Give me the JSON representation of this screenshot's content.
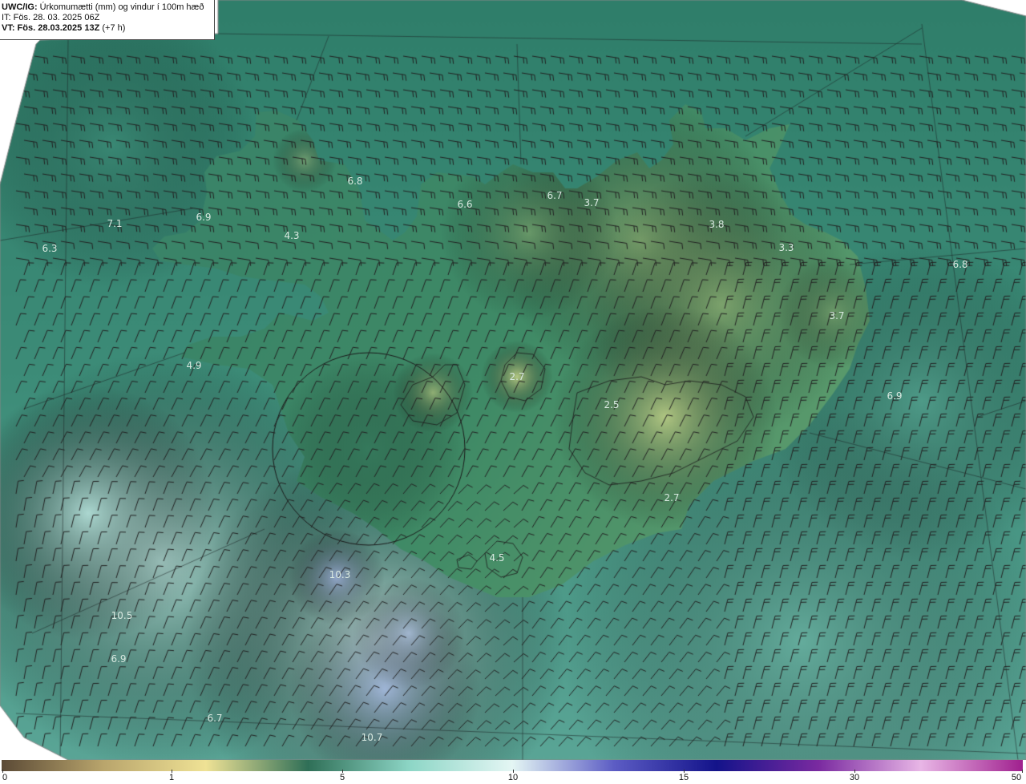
{
  "header": {
    "product": "UWC/IG:",
    "description": "Úrkomumætti (mm) og vindur í 100m hæð",
    "init_time": "IT: Fös. 28. 03. 2025 06Z",
    "valid_label": "VT: Fös. 28.03.2025 13Z",
    "valid_offset": "(+7 h)"
  },
  "value_labels": [
    "6.8",
    "6.6",
    "6.7",
    "3.7",
    "6.9",
    "7.1",
    "6.3",
    "4.3",
    "3.8",
    "3.3",
    "6.8",
    "3.7",
    "4.9",
    "2.7",
    "2.5",
    "6.9",
    "2.7",
    "4.5",
    "10.3",
    "10.5",
    "6.9",
    "6.7",
    "10.7"
  ],
  "colorbar": {
    "ticks": [
      "0",
      "1",
      "5",
      "10",
      "15",
      "30",
      "50"
    ],
    "colors": [
      "#5b4a36",
      "#b9a56c",
      "#efe295",
      "#2f6f57",
      "#8dd6c6",
      "#e4f6f4",
      "#5c5cc4",
      "#13138a",
      "#7a2aa0",
      "#e8b6e6",
      "#a0208e"
    ]
  },
  "colors": {
    "sea_dark": "#2f7a68",
    "sea_light": "#bfe9e6",
    "land_low": "#2c6e55",
    "land_high": "#cfd88a",
    "coastline": "#1a1a1a",
    "barb": "#222222"
  }
}
